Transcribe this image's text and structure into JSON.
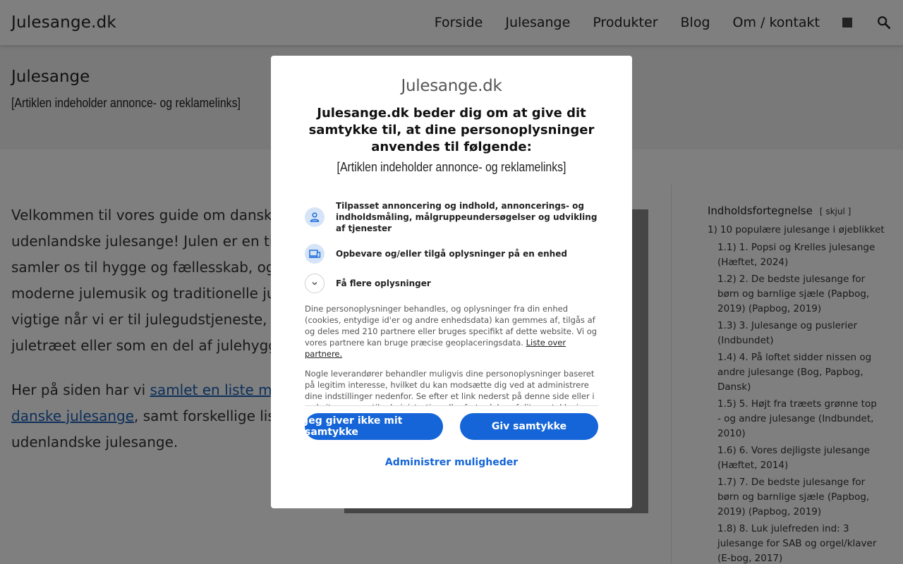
{
  "header": {
    "logo": "Julesange.dk",
    "nav": [
      "Forside",
      "Julesange",
      "Produkter",
      "Blog",
      "Om / kontakt"
    ],
    "search_icon": "search-icon"
  },
  "title_band": {
    "title": "Julesange",
    "note": "[Artiklen indeholder annonce- og reklamelinks]"
  },
  "main": {
    "p1": "Velkommen til vores guide om danske og udenlandske julesange! Julen er en tid d samler os til hygge og fællesskab, og bå moderne julemusik og traditionelle julesa vigtige når vi er til julegudstjeneste, dans juletræet eller som en del af julehyggen.",
    "p2_pre": "Her på siden har vi ",
    "p2_link": "samlet en liste med b danske julesange",
    "p2_post": ", samt forskellige lister udenlandske julesange."
  },
  "toc": {
    "title": "Indholdsfortegnelse",
    "toggle": "[ skjul ]",
    "l1_num": "1)",
    "l1": "10 populære julesange i øjeblikket",
    "items": [
      {
        "num": "1.1)",
        "text": "1. Popsi og Krelles julesange (Hæftet, 2024)"
      },
      {
        "num": "1.2)",
        "text": "2. De bedste julesange for børn og barnlige sjæle (Papbog, 2019) (Papbog, 2019)"
      },
      {
        "num": "1.3)",
        "text": "3. Julesange og puslerier (Indbundet)"
      },
      {
        "num": "1.4)",
        "text": "4. På loftet sidder nissen og andre julesange (Bog, Papbog, Dansk)"
      },
      {
        "num": "1.5)",
        "text": "5. Højt fra træets grønne top - og andre julesange (Indbundet, 2010)"
      },
      {
        "num": "1.6)",
        "text": "6. Vores dejligste julesange (Hæftet, 2014)"
      },
      {
        "num": "1.7)",
        "text": "7. De bedste julesange for børn og barnlige sjæle (Papbog, 2019) (Papbog, 2019)"
      },
      {
        "num": "1.8)",
        "text": "8. Luk julefreden ind: 3 julesange for SAB og orgel/klaver (E-bog, 2017)"
      }
    ]
  },
  "consent": {
    "logo": "Julesange.dk",
    "title": "Julesange.dk beder dig om at give dit samtykke til, at dine personoplysninger anvendes til følgende:",
    "subtitle": "[Artiklen indeholder annonce- og reklamelinks]",
    "purpose1": "Tilpasset annoncering og indhold, annoncerings- og indholdsmåling, målgruppeundersøgelser og udvikling af tjenester",
    "purpose2": "Opbevare og/eller tilgå oplysninger på en enhed",
    "purpose3": "Få flere oplysninger",
    "body1": "Dine personoplysninger behandles, og oplysninger fra din enhed (cookies, entydige id'er og andre enhedsdata) kan gemmes af, tilgås af og deles med 210 partnere eller bruges specifikt af dette website. Vi og vores partnere kan bruge præcise geoplaceringsdata.",
    "partners_link": "Liste over partnere.",
    "body2": "Nogle leverandører behandler muligvis dine personoplysninger baseret på legitim interesse, hvilket du kan modsætte dig ved at administrere dine indstillinger nedenfor. Se efter et link nederst på denne side eller i websitemenuen til administration eller fortrydelse af dit samtykke i privatlivs- og cookieindstillingerne.",
    "btn_decline": "Jeg giver ikke mit samtykke",
    "btn_accept": "Giv samtykke",
    "manage": "Administrer muligheder"
  },
  "colors": {
    "accent": "#1565d8",
    "link": "#1a5fb4",
    "icon_bg": "#d6e4f7"
  }
}
